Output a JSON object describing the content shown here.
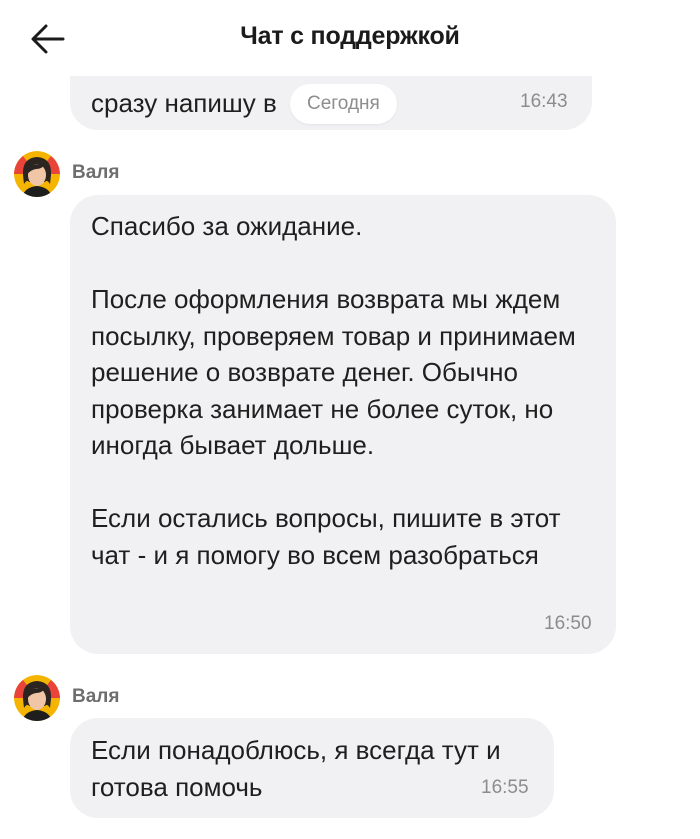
{
  "header": {
    "title": "Чат с поддержкой",
    "back_icon": "arrow-left-icon"
  },
  "date_chip": "Сегодня",
  "messages": [
    {
      "text": "сразу напишу в",
      "time": "16:43"
    },
    {
      "sender": "Валя",
      "text": "Спасибо за ожидание.\n\nПосле оформления возврата мы ждем посылку, проверяем товар и принимаем решение о возврате денег. Обычно проверка занимает не более суток, но иногда бывает дольше.\n\nЕсли остались вопросы, пишите в этот чат - и я помогу во всем разобраться",
      "time": "16:50"
    },
    {
      "sender": "Валя",
      "text": "Если понадоблюсь, я всегда тут и готова помочь",
      "time": "16:55"
    }
  ],
  "colors": {
    "bubble": "#f1f1f3",
    "time": "#8c8c8c",
    "sender": "#6e6e6e",
    "avatar_ring": "#f4b400"
  }
}
